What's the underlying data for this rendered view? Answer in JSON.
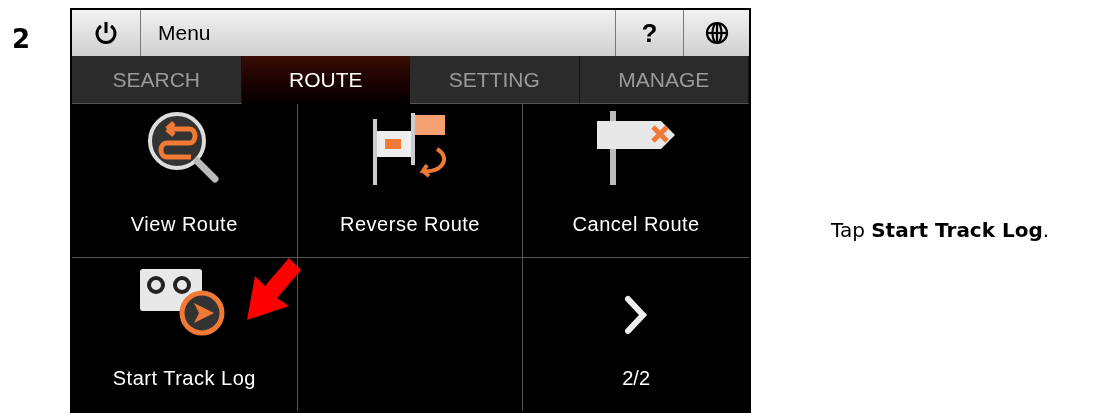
{
  "step": "2",
  "top_bar": {
    "title": "Menu",
    "help": "?"
  },
  "tabs": [
    {
      "label": "SEARCH",
      "selected": false
    },
    {
      "label": "ROUTE",
      "selected": true
    },
    {
      "label": "SETTING",
      "selected": false
    },
    {
      "label": "MANAGE",
      "selected": false
    }
  ],
  "grid": [
    {
      "kind": "action",
      "label": "View Route"
    },
    {
      "kind": "action",
      "label": "Reverse Route"
    },
    {
      "kind": "action",
      "label": "Cancel Route"
    },
    {
      "kind": "action",
      "label": "Start Track Log",
      "pointed": true
    },
    {
      "kind": "empty"
    },
    {
      "kind": "pager",
      "label": "2/2"
    }
  ],
  "instruction": "Tap **Start Track Log**."
}
